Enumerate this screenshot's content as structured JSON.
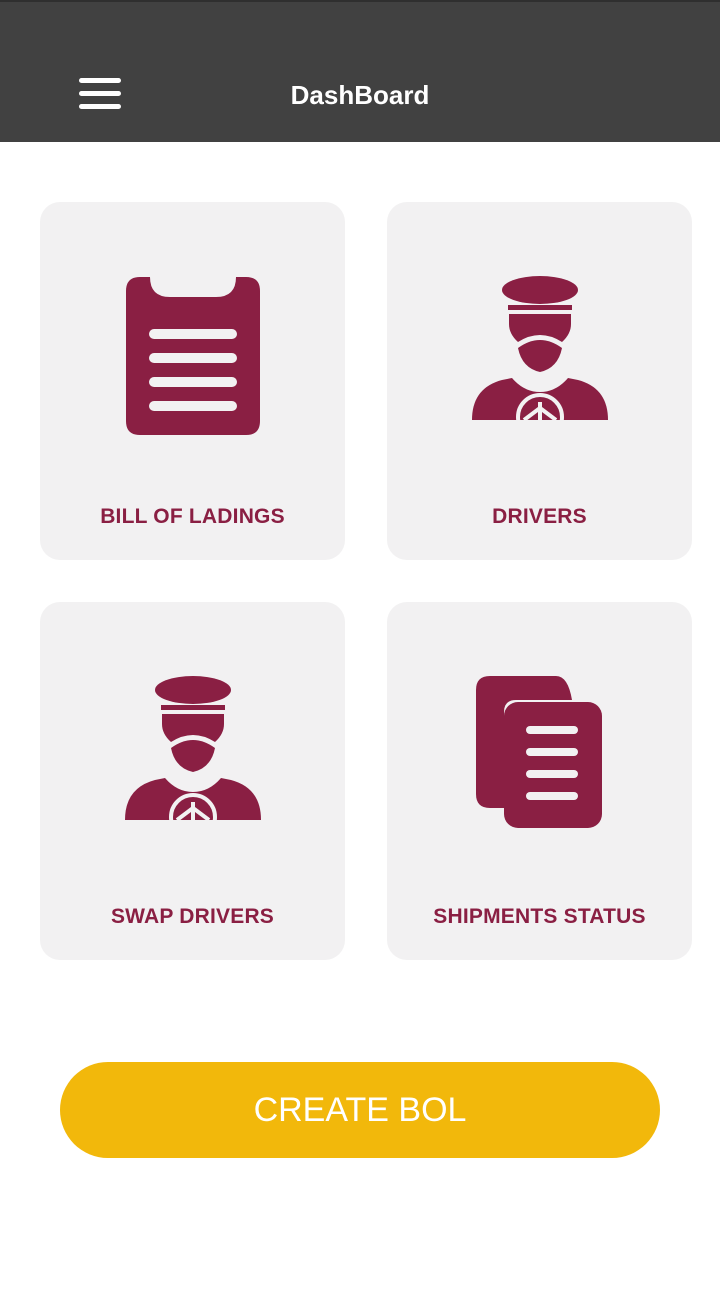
{
  "header": {
    "title": "DashBoard",
    "menu_icon": "hamburger-menu-icon"
  },
  "tiles": [
    {
      "label": "BILL OF LADINGS",
      "icon": "clipboard-list-icon"
    },
    {
      "label": "DRIVERS",
      "icon": "driver-icon"
    },
    {
      "label": "SWAP DRIVERS",
      "icon": "driver-icon"
    },
    {
      "label": "SHIPMENTS STATUS",
      "icon": "documents-icon"
    }
  ],
  "create_button": {
    "label": "CREATE BOL"
  },
  "colors": {
    "app_bar": "#414141",
    "accent": "#8a1f43",
    "tile_background": "#f2f1f2",
    "button": "#f2b80b"
  }
}
